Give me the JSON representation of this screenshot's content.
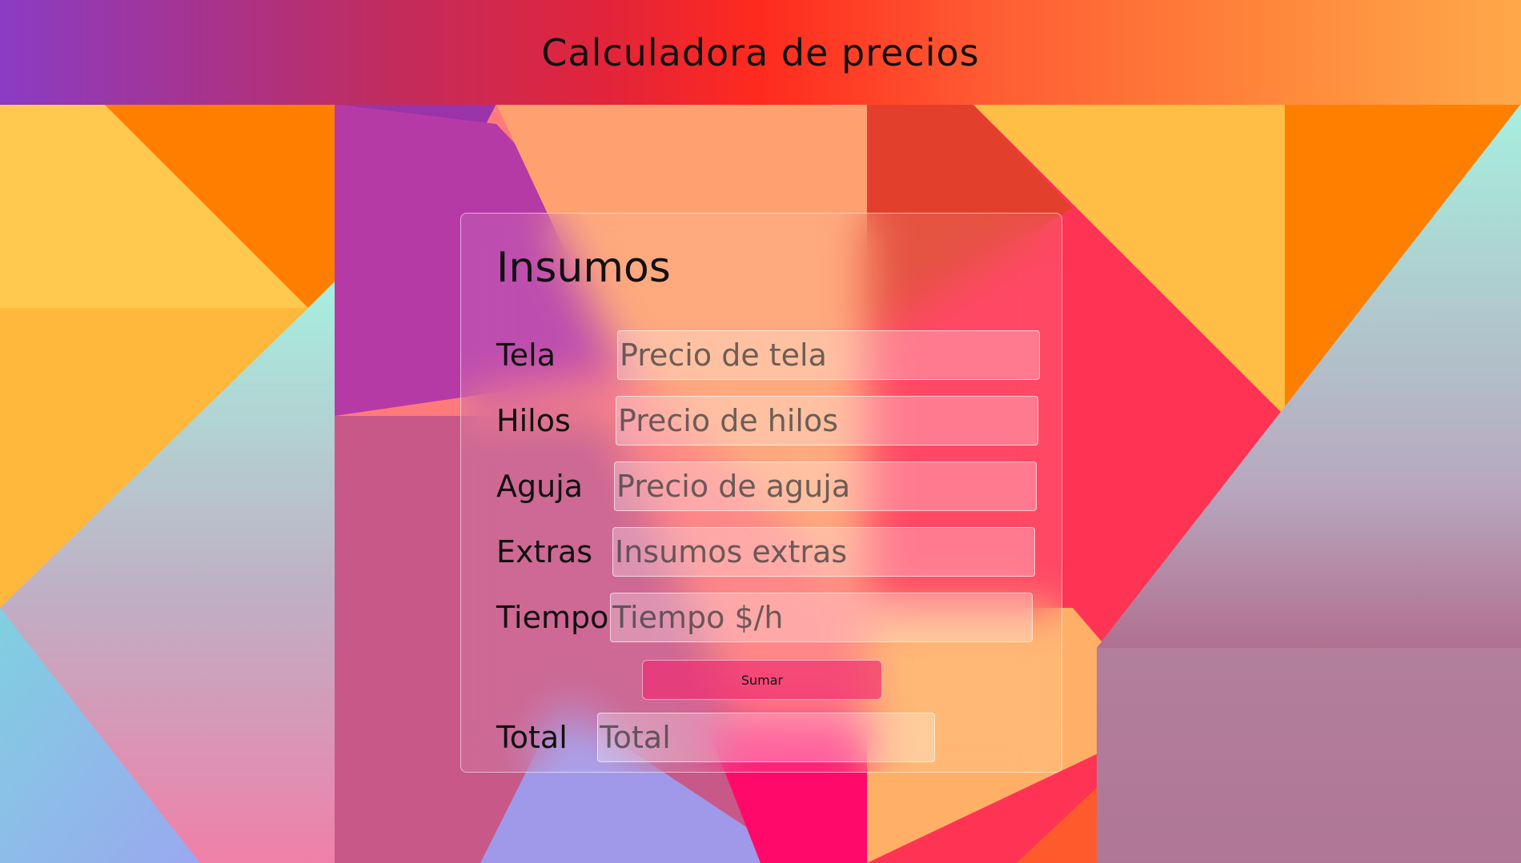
{
  "header": {
    "title": "Calculadora de precios"
  },
  "card": {
    "title": "Insumos",
    "fields": [
      {
        "label": "Tela",
        "placeholder": "Precio de tela",
        "value": ""
      },
      {
        "label": "Hilos",
        "placeholder": "Precio de hilos",
        "value": ""
      },
      {
        "label": "Aguja",
        "placeholder": "Precio de aguja",
        "value": ""
      },
      {
        "label": "Extras",
        "placeholder": "Insumos extras",
        "value": ""
      },
      {
        "label": "Tiempo",
        "placeholder": "Tiempo $/h",
        "value": ""
      }
    ],
    "button_label": "Sumar",
    "total": {
      "label": "Total",
      "placeholder": "Total",
      "value": ""
    }
  },
  "colors": {
    "header_start": "#8a3cc4",
    "header_mid": "#ff2a1e",
    "header_end": "#ffa94a",
    "button": "#f0286e"
  }
}
